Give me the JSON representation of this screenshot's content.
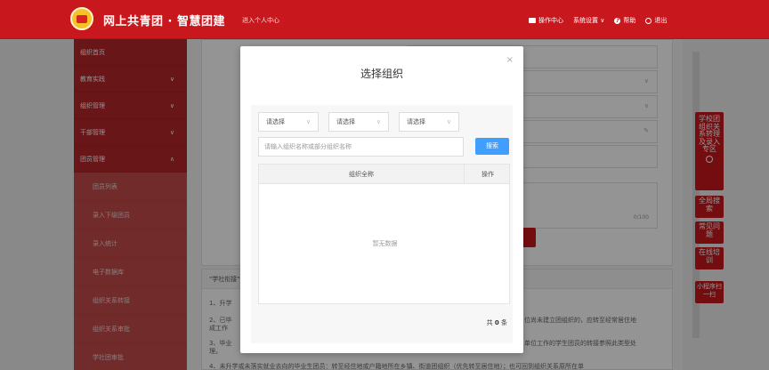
{
  "header": {
    "brand": "网上共青团 · 智慧团建",
    "subtitle": "进入个人中心",
    "links": {
      "workbench": "操作中心",
      "settings": "系统设置 ∨",
      "help": "帮助",
      "logout": "退出"
    }
  },
  "sidebar": {
    "items": [
      {
        "label": "组织首页",
        "chevron": ""
      },
      {
        "label": "教育实践",
        "chevron": "∨"
      },
      {
        "label": "组织管理",
        "chevron": "∨"
      },
      {
        "label": "干部管理",
        "chevron": "∨"
      },
      {
        "label": "团员管理",
        "chevron": "∧"
      }
    ],
    "sub_items": [
      "团员列表",
      "录入下级团员",
      "录入统计",
      "电子数据库",
      "组织关系转接",
      "组织关系审批",
      "学社团审批"
    ]
  },
  "background": {
    "counter": "0/100",
    "notes_title": "\"学社衔接\"",
    "notes": [
      "1、升学",
      "2、已毕",
      "成工作",
      "3、毕业",
      "理。",
      "位尚未建立团组织的，应转至经常居住地",
      "单位工作的学生团员的转接参照此类型处",
      "4、未升学或未落实就业去向的毕业生团员：转至经住地或户籍地所在乡镇、街道团组织（优先转至居住地）；也可回到组织关系原所在单"
    ]
  },
  "rail": {
    "buttons": [
      {
        "label": "学校团组织关系转理及录入专区"
      },
      {
        "label": "全局搜索"
      },
      {
        "label": "常见问题"
      },
      {
        "label": "在线培训"
      },
      {
        "label": "小程序扫一扫"
      }
    ]
  },
  "modal": {
    "title": "选择组织",
    "close": "×",
    "selects": [
      "请选择",
      "请选择",
      "请选择"
    ],
    "search_placeholder": "请输入组织名称或部分组织名称",
    "search_button": "搜索",
    "table": {
      "col_name": "组织全称",
      "col_action": "操作",
      "empty_text": "暂无数据"
    },
    "total_prefix": "共",
    "total_count": "0",
    "total_suffix": "条"
  }
}
